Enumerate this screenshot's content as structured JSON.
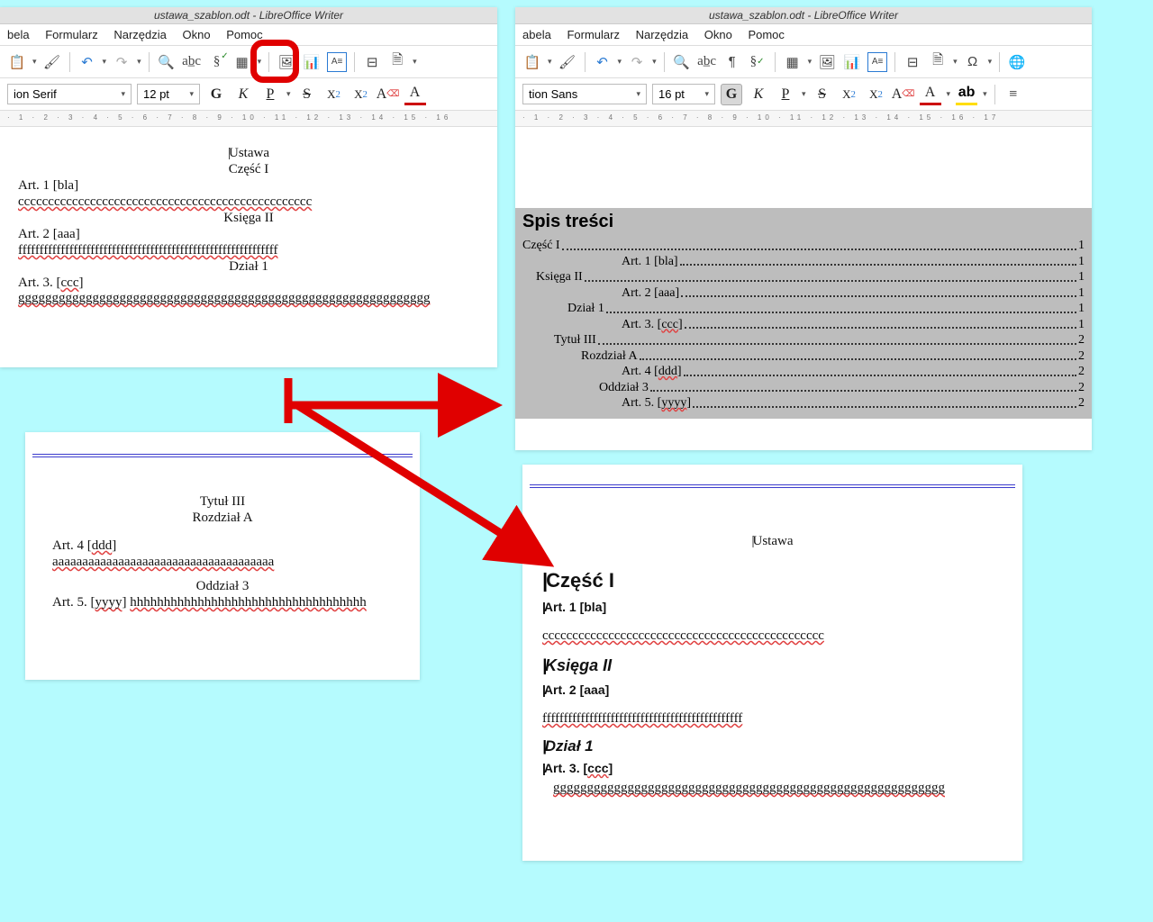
{
  "left": {
    "title": "ustawa_szablon.odt - LibreOffice Writer",
    "menu": {
      "m1": "bela",
      "m2": "Formularz",
      "m3": "Narzędzia",
      "m4": "Okno",
      "m5": "Pomoc"
    },
    "font": "ion Serif",
    "size": "12 pt",
    "doc": {
      "l1": "Ustawa",
      "l2": "Część I",
      "l3": "Art. 1 [bla]",
      "l4": "ccccccccccccccccccccccccccccccccccccccccccccccccc",
      "l5": "Księga II",
      "l6": "Art. 2 [aaa]",
      "l7": "fffffffffffffffffffffffffffffffffffffffffffffffffffffffffffff",
      "l8": "Dział 1",
      "l9a": "Art. 3.  [",
      "l9b": "ccc",
      "l9c": "]  ",
      "l9d": "ggggggggggggggggggggggggggggggggggggggggggggggggggggggggggggg"
    }
  },
  "left2": {
    "l1": "Tytuł III",
    "l2": "Rozdział A",
    "l3a": "Art. 4 [",
    "l3b": "ddd",
    "l3c": "]",
    "l4": "aaaaaaaaaaaaaaaaaaaaaaaaaaaaaaaaaaaaa",
    "l5": "Oddział 3",
    "l6a": "Art. 5. [",
    "l6b": "yyyy",
    "l6c": "] ",
    "l6d": "hhhhhhhhhhhhhhhhhhhhhhhhhhhhhhhhhhh"
  },
  "right": {
    "title": "ustawa_szablon.odt - LibreOffice Writer",
    "menu": {
      "m1": "abela",
      "m2": "Formularz",
      "m3": "Narzędzia",
      "m4": "Okno",
      "m5": "Pomoc"
    },
    "font": "tion Sans",
    "size": "16 pt",
    "toc_title": "Spis treści",
    "toc": [
      {
        "indent": 0,
        "label": "Część I",
        "page": "1"
      },
      {
        "indent": 110,
        "label": "Art. 1 [bla]",
        "page": "1"
      },
      {
        "indent": 15,
        "label": "Księga II",
        "page": "1"
      },
      {
        "indent": 110,
        "label": "Art. 2 [aaa]",
        "page": "1"
      },
      {
        "indent": 50,
        "label": "Dział 1",
        "page": "1"
      },
      {
        "indent": 110,
        "label_pre": "Art. 3. [",
        "label_wavy": "ccc",
        "label_post": "]",
        "page": "1"
      },
      {
        "indent": 35,
        "label": "Tytuł III",
        "page": "2"
      },
      {
        "indent": 65,
        "label": "Rozdział A",
        "page": "2"
      },
      {
        "indent": 110,
        "label_pre": "Art. 4 [",
        "label_wavy": "ddd",
        "label_post": "]",
        "page": "2"
      },
      {
        "indent": 85,
        "label": "Oddział 3",
        "page": "2"
      },
      {
        "indent": 110,
        "label_pre": "Art. 5. [",
        "label_wavy": "yyyy",
        "label_post": "]",
        "page": "2"
      }
    ]
  },
  "rb": {
    "l1": "Ustawa",
    "h1": "Część I",
    "a1": "Art. 1 [bla]",
    "c1": "ccccccccccccccccccccccccccccccccccccccccccccccc",
    "h2": "Księga II",
    "a2": "Art. 2 [aaa]",
    "c2": "fffffffffffffffffffffffffffffffffffffffffffffff",
    "h3": "Dział 1",
    "a3a": "Art. 3.  [",
    "a3b": "ccc",
    "a3c": "]",
    "c3": "gggggggggggggggggggggggggggggggggggggggggggggggggggggggggg"
  }
}
